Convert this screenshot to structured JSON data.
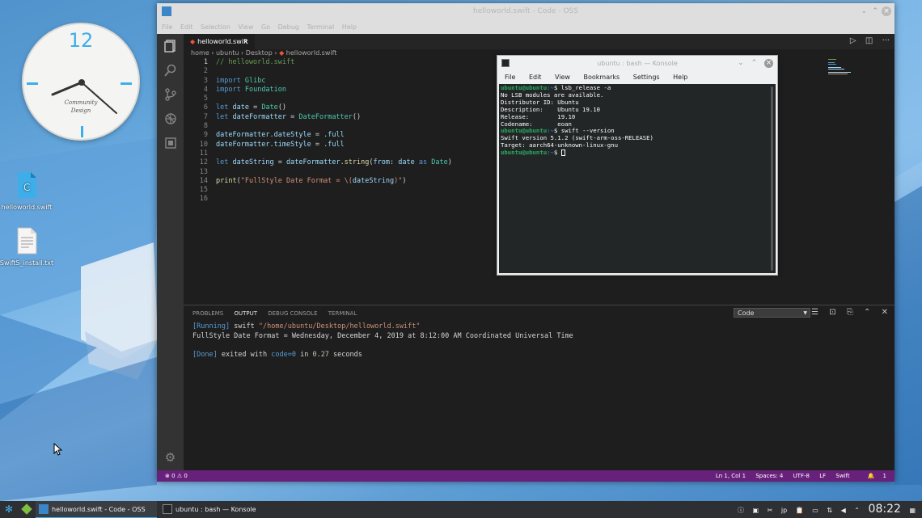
{
  "desktop": {
    "clock": {
      "number": "12",
      "brand_line1": "Community",
      "brand_line2": "Design"
    },
    "icons": [
      {
        "label": "helloworld.swift"
      },
      {
        "label": "Swift5_install.txt"
      }
    ]
  },
  "vscode": {
    "title": "helloworld.swift - Code - OSS",
    "menu": [
      "File",
      "Edit",
      "Selection",
      "View",
      "Go",
      "Debug",
      "Terminal",
      "Help"
    ],
    "tab": {
      "label": "helloworld.swift",
      "close": "×"
    },
    "breadcrumb": [
      "home",
      "ubuntu",
      "Desktop",
      "helloworld.swift"
    ],
    "line_numbers": [
      "1",
      "2",
      "3",
      "4",
      "5",
      "6",
      "7",
      "8",
      "9",
      "10",
      "11",
      "12",
      "13",
      "14",
      "15",
      "16"
    ],
    "code": {
      "l1": "// helloworld.swift",
      "l3_kw": "import",
      "l3_mod": "Glibc",
      "l4_kw": "import",
      "l4_mod": "Foundation",
      "l6_kw": "let",
      "l6_var": "date",
      "l6_rest": " = ",
      "l6_fn": "Date",
      "l6_end": "()",
      "l7_kw": "let",
      "l7_var": "dateFormatter",
      "l7_rest": " = ",
      "l7_fn": "DateFormatter",
      "l7_end": "()",
      "l9_a": "dateFormatter",
      "l9_b": ".dateStyle",
      "l9_c": " = ",
      "l9_d": ".full",
      "l10_a": "dateFormatter",
      "l10_b": ".timeStyle",
      "l10_c": " = ",
      "l10_d": ".full",
      "l12_kw": "let",
      "l12_var": "dateString",
      "l12_rest": " = ",
      "l12_obj": "dateFormatter",
      "l12_fn": ".string",
      "l12_p1": "(",
      "l12_from": "from",
      "l12_p2": ": ",
      "l12_arg": "date",
      "l12_as": " as ",
      "l12_type": "Date",
      "l12_end": ")",
      "l14_fn": "print",
      "l14_p1": "(",
      "l14_str": "\"FullStyle Date Format = \\(",
      "l14_var": "dateString",
      "l14_str2": ")\"",
      "l14_end": ")"
    },
    "panel": {
      "tabs": [
        "PROBLEMS",
        "OUTPUT",
        "DEBUG CONSOLE",
        "TERMINAL"
      ],
      "select_value": "Code",
      "output": {
        "running_tag": "[Running]",
        "running_cmd": " swift ",
        "running_path": "\"/home/ubuntu/Desktop/helloworld.swift\"",
        "result": "FullStyle Date Format = Wednesday, December 4, 2019 at 8:12:00 AM Coordinated Universal Time",
        "done_tag": "[Done]",
        "done_text1": " exited with ",
        "done_code": "code=0",
        "done_text2": " in ",
        "done_time": "0.27",
        "done_text3": " seconds"
      }
    },
    "status": {
      "errors": "0",
      "warnings": "0",
      "position": "Ln 1, Col 1",
      "spaces": "Spaces: 4",
      "encoding": "UTF-8",
      "eol": "LF",
      "language": "Swift",
      "notifications": "1"
    },
    "colors": {
      "statusbar": "#68217a",
      "editor_bg": "#1e1e1e"
    }
  },
  "konsole": {
    "title": "ubuntu : bash — Konsole",
    "menu": [
      "File",
      "Edit",
      "View",
      "Bookmarks",
      "Settings",
      "Help"
    ],
    "prompt_user": "ubuntu@ubuntu",
    "prompt_path": ":~",
    "lines": {
      "cmd1": "$ lsb_release -a",
      "o1": "No LSB modules are available.",
      "o2": "Distributor ID:\tUbuntu",
      "o3": "Description:\tUbuntu 19.10",
      "o4": "Release:\t19.10",
      "o5": "Codename:\teoan",
      "cmd2": "$ swift --version",
      "o6": "Swift version 5.1.2 (swift-arm-oss-RELEASE)",
      "o7": "Target: aarch64-unknown-linux-gnu",
      "cmd3": "$ "
    }
  },
  "taskbar": {
    "items": [
      {
        "label": "helloworld.swift - Code - OSS"
      },
      {
        "label": "ubuntu : bash — Konsole"
      }
    ],
    "keyboard": "jp",
    "time": "08:22"
  }
}
